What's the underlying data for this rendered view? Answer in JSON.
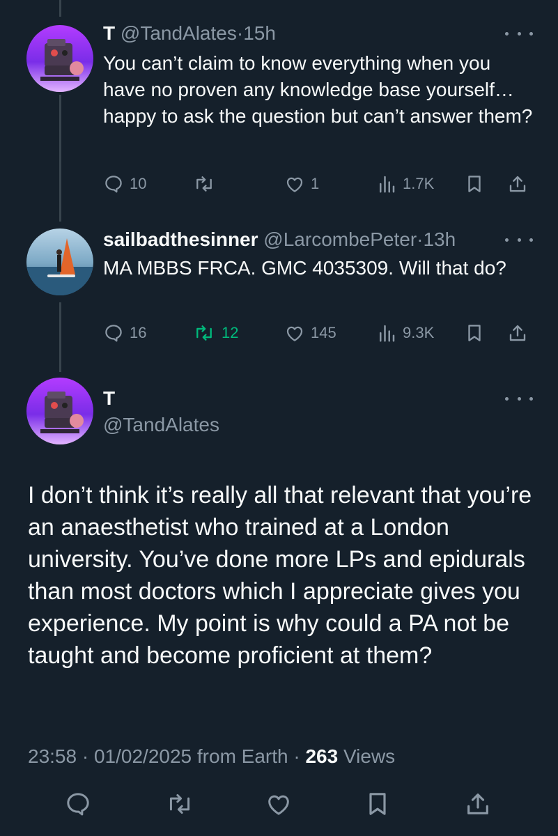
{
  "colors": {
    "background": "#15202b",
    "text_primary": "#f7f9f9",
    "text_secondary": "#8b98a5",
    "retweet_active": "#00ba7c",
    "thread_line": "#38444d"
  },
  "replies": [
    {
      "display_name": "T",
      "handle": "@TandAlates",
      "separator": "·",
      "time": "15h",
      "text": "You can’t claim to know everything when you have no proven any knowledge base yourself… happy to ask the question but can’t answer them?",
      "replies_count": "10",
      "retweets_count": "",
      "likes_count": "1",
      "views_count": "1.7K",
      "icons": [
        "reply-icon",
        "retweet-icon",
        "like-icon",
        "views-icon",
        "bookmark-icon",
        "share-icon"
      ]
    },
    {
      "display_name": "sailbadthesinner",
      "handle": "@LarcombePeter",
      "separator": "·",
      "time": "13h",
      "text": "MA MBBS FRCA. GMC 4035309. Will that do?",
      "replies_count": "16",
      "retweets_count": "12",
      "likes_count": "145",
      "views_count": "9.3K",
      "retweeted": true,
      "icons": [
        "reply-icon",
        "retweet-icon",
        "like-icon",
        "views-icon",
        "bookmark-icon",
        "share-icon"
      ]
    }
  ],
  "main_tweet": {
    "display_name": "T",
    "handle": "@TandAlates",
    "text": "I don’t think it’s really all that relevant that you’re an anaesthetist who trained at a London university. You’ve done more LPs and epidurals than most doctors which I appreciate gives you experience. My point is why could a PA not be taught and become proficient at them?",
    "time": "23:58",
    "date": "01/02/2025",
    "source": "from Earth",
    "views_number": "263",
    "views_label": "Views",
    "separator": "·"
  },
  "bottom_actions": [
    "reply-icon",
    "retweet-icon",
    "like-icon",
    "bookmark-icon",
    "share-icon"
  ]
}
